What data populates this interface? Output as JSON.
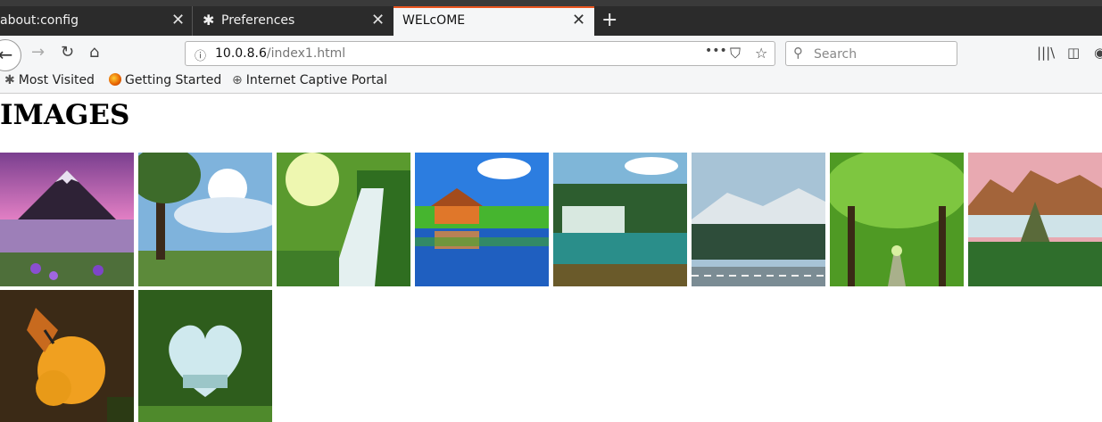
{
  "browser": {
    "tabs": [
      {
        "label": "about:config"
      },
      {
        "label": "Preferences"
      },
      {
        "label": "WELcOME"
      }
    ],
    "url": {
      "host": "10.0.8.6",
      "path": "/index1.html"
    },
    "search": {
      "placeholder": "Search"
    },
    "bookmarks": [
      {
        "label": "Most Visited"
      },
      {
        "label": "Getting Started"
      },
      {
        "label": "Internet Captive Portal"
      }
    ]
  },
  "page": {
    "heading": "IMAGES",
    "images": [
      {
        "name": "mountain-lake-flowers",
        "colors": [
          "#c95fb7",
          "#2f1f3e",
          "#6b8e4e"
        ]
      },
      {
        "name": "tree-sun-sky",
        "colors": [
          "#8fc3e8",
          "#2d4a2b",
          "#5c7c3c"
        ]
      },
      {
        "name": "forest-waterfall",
        "colors": [
          "#d6e88d",
          "#3e7d28",
          "#a8c9c0"
        ]
      },
      {
        "name": "house-reflection",
        "colors": [
          "#2c7de0",
          "#3fa52c",
          "#f08a2c"
        ]
      },
      {
        "name": "tropical-waterfall",
        "colors": [
          "#7fb6d8",
          "#2d5d2f",
          "#2a8e8a"
        ]
      },
      {
        "name": "mountain-road",
        "colors": [
          "#a7c3d6",
          "#2e4d3a",
          "#7b8c94"
        ]
      },
      {
        "name": "green-tree-tunnel",
        "colors": [
          "#7ec640",
          "#2e6e1a",
          "#a9b08b"
        ]
      },
      {
        "name": "misty-karst-mountains",
        "colors": [
          "#e8a9b1",
          "#a3643a",
          "#2f6e2c"
        ]
      },
      {
        "name": "butterfly-orange-flower",
        "colors": [
          "#3b2a16",
          "#f0a020",
          "#2b3a14"
        ]
      },
      {
        "name": "heart-shaped-foliage",
        "colors": [
          "#2e5d1c",
          "#cfe9ee",
          "#4f8a2c"
        ]
      }
    ]
  }
}
